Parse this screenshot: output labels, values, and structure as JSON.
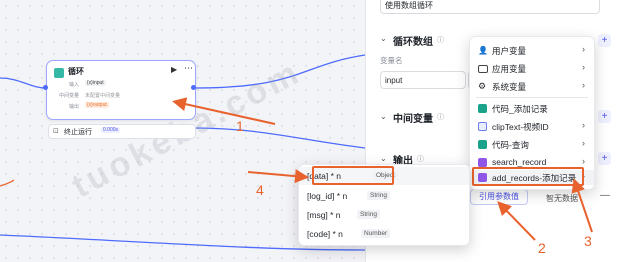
{
  "canvas": {
    "loop_node": {
      "title": "循环",
      "input_label": "输入",
      "input_chip": "{x}input",
      "middle_label": "中间变量",
      "middle_value": "未配置中间变量",
      "output_label": "输出",
      "output_chip": "{x}output"
    },
    "terminate_node": {
      "label": "终止运行",
      "time": "0.000s"
    }
  },
  "panel": {
    "loop_type_select": "使用数组循环",
    "loop_array_title": "循环数组",
    "variable_name_label": "变量名",
    "input_value": "input",
    "middle_var_title": "中间变量",
    "output_title": "输出",
    "ref_button": "引用参数值",
    "right_tab": "智无数据"
  },
  "dropdown": {
    "items": [
      {
        "label": "用户变量",
        "icon": "user-icon",
        "arrow": "›"
      },
      {
        "label": "应用变量",
        "icon": "folder-icon",
        "arrow": "›"
      },
      {
        "label": "系统变量",
        "icon": "gear-icon",
        "arrow": "›"
      },
      {
        "label": "代码_添加记录",
        "icon": "code-icon",
        "arrow": ""
      },
      {
        "label": "clipText-视频ID",
        "icon": "clip-icon",
        "arrow": "›"
      },
      {
        "label": "代码-查询",
        "icon": "code-icon",
        "arrow": "›"
      },
      {
        "label": "search_record",
        "icon": "database-icon",
        "arrow": "›"
      },
      {
        "label": "add_records-添加记录",
        "icon": "database-icon",
        "arrow": "›"
      }
    ]
  },
  "varlist": {
    "items": [
      {
        "name": "[data] * n",
        "type": "Object"
      },
      {
        "name": "[log_id] * n",
        "type": "String"
      },
      {
        "name": "[msg] * n",
        "type": "String"
      },
      {
        "name": "[code] * n",
        "type": "Number"
      }
    ]
  },
  "annotations": {
    "n1": "1",
    "n2": "2",
    "n3": "3",
    "n4": "4"
  },
  "watermark": "tuokeba.com",
  "colors": {
    "accent": "#4d53e8",
    "annotation": "#e8622e",
    "loop_icon": "#35b8a6",
    "code_icon": "#1aa38a",
    "db_icon": "#8f56e8"
  }
}
